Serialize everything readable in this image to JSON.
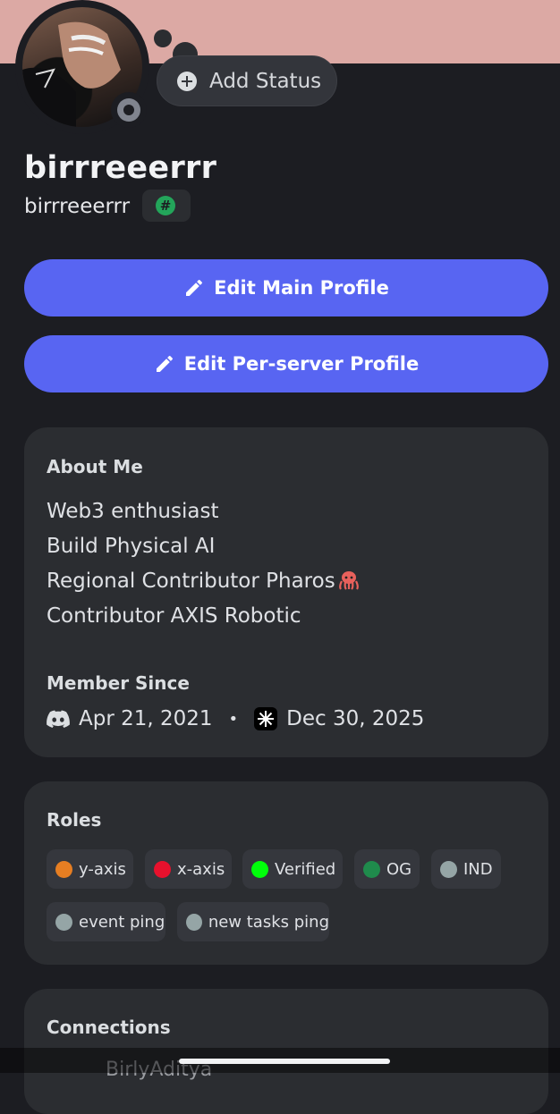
{
  "profile": {
    "display_name": "birrreeerrr",
    "username": "birrreeerrr",
    "tag_symbol": "#",
    "add_status_label": "Add Status",
    "status": "offline"
  },
  "buttons": {
    "edit_main": "Edit Main Profile",
    "edit_server": "Edit Per-server Profile"
  },
  "about": {
    "title": "About Me",
    "lines": [
      "Web3 enthusiast",
      "Build Physical AI",
      "Regional Contributor Pharos",
      "Contributor AXIS Robotic"
    ]
  },
  "member_since": {
    "title": "Member Since",
    "discord_date": "Apr 21, 2021",
    "separator": "•",
    "server_date": "Dec 30, 2025"
  },
  "roles": {
    "title": "Roles",
    "items": [
      {
        "name": "y-axis",
        "color": "#e67e22"
      },
      {
        "name": "x-axis",
        "color": "#e8112d"
      },
      {
        "name": "Verified",
        "color": "#00ff0a"
      },
      {
        "name": "OG",
        "color": "#1f8b4c"
      },
      {
        "name": "IND",
        "color": "#95a5a6"
      },
      {
        "name": "event ping",
        "color": "#95a5a6"
      },
      {
        "name": "new tasks ping",
        "color": "#95a5a6"
      }
    ]
  },
  "connections": {
    "title": "Connections",
    "first_account": "BirlyAditya"
  },
  "colors": {
    "banner": "#dca9a4",
    "accent": "#5865f2",
    "card": "#2b2d31",
    "background": "#1c1d22"
  }
}
